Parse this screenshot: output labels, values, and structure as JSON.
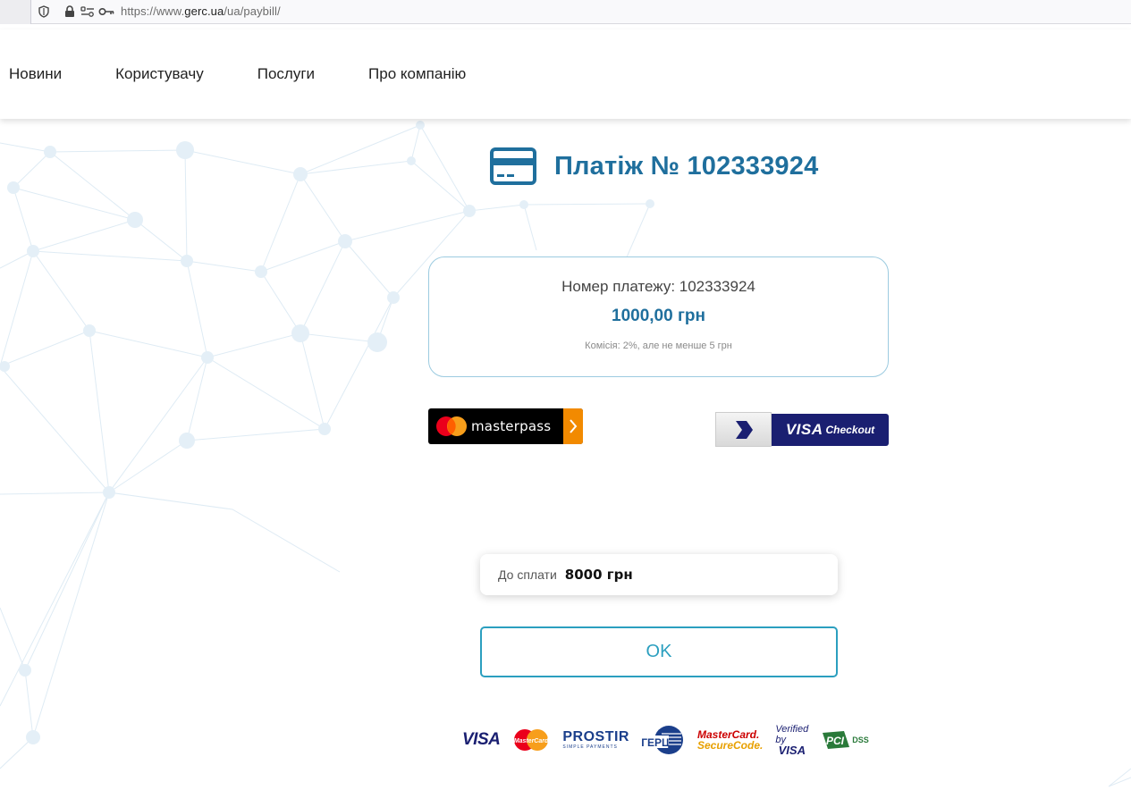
{
  "browser": {
    "url_prefix": "https://www.",
    "url_domain": "gerc.ua",
    "url_path": "/ua/paybill/"
  },
  "nav": {
    "items": [
      "Новини",
      "Користувачу",
      "Послуги",
      "Про компанію"
    ]
  },
  "payment": {
    "title": "Платіж № 102333924",
    "number_line": "Номер платежу: 102333924",
    "amount": "1000,00 грн",
    "fee_note": "Комісія: 2%, але не менше 5 грн"
  },
  "wallets": {
    "masterpass_label": "masterpass",
    "visa_checkout_brand": "VISA",
    "visa_checkout_label": "Checkout"
  },
  "to_pay": {
    "label": "До сплати",
    "value": "8000 грн"
  },
  "ok_label": "OK",
  "footer_logos": {
    "visa": "VISA",
    "mastercard": "MasterCard",
    "prostir": "PROSTIR",
    "prostir_sub": "SIMPLE PAYMENTS",
    "gerc": "ГЕРЦ",
    "mc_securecode_1": "MasterCard.",
    "mc_securecode_2": "SecureCode.",
    "vbv_1": "Verified by",
    "vbv_2": "VISA",
    "pci": "PCI",
    "pci_dss": "DSS"
  },
  "colors": {
    "brand_blue": "#1f6f9d",
    "accent_teal": "#2b9fbf",
    "masterpass_orange": "#f28a00",
    "visa_navy": "#1a1f71"
  }
}
